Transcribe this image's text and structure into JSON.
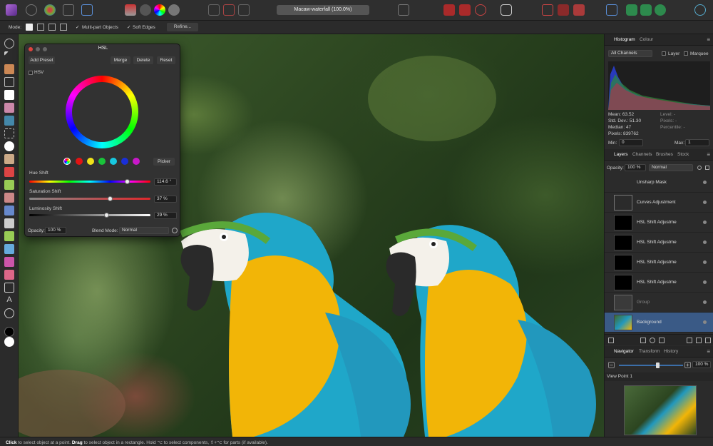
{
  "document_title": "Macaw-waterfall (100.0%)",
  "context": {
    "mode_label": "Mode:",
    "multipart_label": "Multi-part Objects",
    "soft_edges_label": "Soft Edges",
    "refine_label": "Refine..."
  },
  "status": {
    "text_click": "Click",
    "text_1": " to select object at a point. ",
    "text_drag": "Drag",
    "text_2": " to select object in a rectangle. Hold ⌥ to select components, ⇧+⌥ for parts (if available)."
  },
  "hsl": {
    "title": "HSL",
    "add_preset": "Add Preset",
    "merge": "Merge",
    "delete": "Delete",
    "reset": "Reset",
    "hsv_label": "HSV",
    "picker_label": "Picker",
    "hue_label": "Hue Shift",
    "hue_value": "114.6 °",
    "hue_fraction": 0.81,
    "sat_label": "Saturation Shift",
    "sat_value": "37 %",
    "sat_fraction": 0.67,
    "lum_label": "Luminosity Shift",
    "lum_value": "29 %",
    "lum_fraction": 0.64,
    "opacity_label": "Opacity:",
    "opacity_value": "100 %",
    "blend_label": "Blend Mode:",
    "blend_value": "Normal"
  },
  "histogram": {
    "tab_histogram": "Histogram",
    "tab_colour": "Colour",
    "channels": "All Channels",
    "layer_label": "Layer",
    "marquee_label": "Marquee",
    "mean": "Mean: 63.52",
    "std": "Std. Dev.: 51.30",
    "median": "Median: 47",
    "pixels": "Pixels: 839762",
    "level": "Level: -",
    "pixels2": "Pixels: -",
    "percentile": "Percentile: -",
    "min_label": "Min:",
    "min_value": "0",
    "max_label": "Max:",
    "max_value": "1"
  },
  "layers_panel": {
    "tab_layers": "Layers",
    "tab_channels": "Channels",
    "tab_brushes": "Brushes",
    "tab_stock": "Stock",
    "opacity_label": "Opacity:",
    "opacity_value": "100 %",
    "blend_value": "Normal",
    "layers": [
      {
        "name": "Unsharp Mask"
      },
      {
        "name": "Curves Adjustment"
      },
      {
        "name": "HSL Shift Adjustme"
      },
      {
        "name": "HSL Shift Adjustme"
      },
      {
        "name": "HSL Shift Adjustme"
      },
      {
        "name": "HSL Shift Adjustme"
      },
      {
        "name": "Group"
      },
      {
        "name": "Background"
      }
    ]
  },
  "navigator": {
    "tab_navigator": "Navigator",
    "tab_transform": "Transform",
    "tab_history": "History",
    "zoom_value": "100 %",
    "view_point": "View Point 1"
  },
  "colors": {
    "accent": "#3b6ea8",
    "selected_layer": "#3a5a86"
  }
}
